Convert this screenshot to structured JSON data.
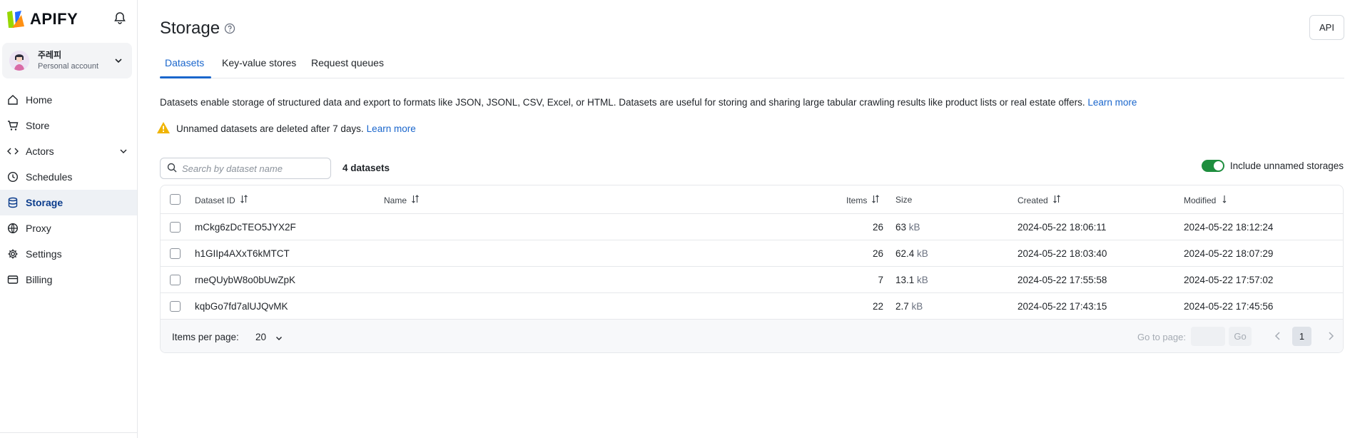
{
  "brand": {
    "name": "APIFY"
  },
  "account": {
    "name": "주레피",
    "type": "Personal account"
  },
  "nav": [
    {
      "label": "Home",
      "icon": "home-icon"
    },
    {
      "label": "Store",
      "icon": "cart-icon"
    },
    {
      "label": "Actors",
      "icon": "code-icon"
    },
    {
      "label": "Schedules",
      "icon": "clock-icon"
    },
    {
      "label": "Storage",
      "icon": "database-icon",
      "active": true
    },
    {
      "label": "Proxy",
      "icon": "globe-icon"
    },
    {
      "label": "Settings",
      "icon": "gear-icon"
    },
    {
      "label": "Billing",
      "icon": "billing-icon"
    }
  ],
  "page": {
    "title": "Storage",
    "api_label": "API",
    "tabs": [
      "Datasets",
      "Key-value stores",
      "Request queues"
    ],
    "description": "Datasets enable storage of structured data and export to formats like JSON, JSONL, CSV, Excel, or HTML. Datasets are useful for storing and sharing large tabular crawling results like product lists or real estate offers.",
    "learn_more": "Learn more",
    "warning": "Unnamed datasets are deleted after 7 days.",
    "search_placeholder": "Search by dataset name",
    "count_label": "4 datasets",
    "toggle_label": "Include unnamed storages"
  },
  "table": {
    "columns": [
      "Dataset ID",
      "Name",
      "Items",
      "Size",
      "Created",
      "Modified"
    ],
    "rows": [
      {
        "id": "mCkg6zDcTEO5JYX2F",
        "name": "",
        "items": "26",
        "size": "63",
        "unit": "kB",
        "created": "2024-05-22 18:06:11",
        "modified": "2024-05-22 18:12:24"
      },
      {
        "id": "h1GIIp4AXxT6kMTCT",
        "name": "",
        "items": "26",
        "size": "62.4",
        "unit": "kB",
        "created": "2024-05-22 18:03:40",
        "modified": "2024-05-22 18:07:29"
      },
      {
        "id": "rneQUybW8o0bUwZpK",
        "name": "",
        "items": "7",
        "size": "13.1",
        "unit": "kB",
        "created": "2024-05-22 17:55:58",
        "modified": "2024-05-22 17:57:02"
      },
      {
        "id": "kqbGo7fd7alUJQvMK",
        "name": "",
        "items": "22",
        "size": "2.7",
        "unit": "kB",
        "created": "2024-05-22 17:43:15",
        "modified": "2024-05-22 17:45:56"
      }
    ],
    "footer": {
      "items_per_page_label": "Items per page:",
      "items_per_page": "20",
      "go_to_page": "Go to page:",
      "go_label": "Go",
      "current_page": "1"
    }
  },
  "colors": {
    "accent": "#1a66cc",
    "toggle_on": "#1e8e3e",
    "warning": "#f0b400"
  }
}
